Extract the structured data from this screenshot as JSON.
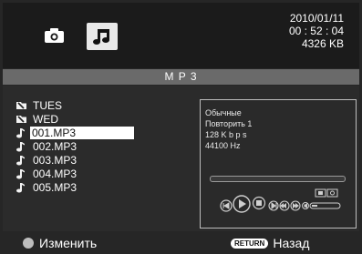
{
  "header": {
    "date": "2010/01/11",
    "time": "00 : 52 : 04",
    "size": "4326  KB",
    "icons": [
      "photo-icon",
      "music-icon"
    ]
  },
  "title": "M P 3",
  "files": [
    {
      "label": "TUES",
      "icon": "folder-icon",
      "selected": false
    },
    {
      "label": "WED",
      "icon": "folder-icon",
      "selected": false
    },
    {
      "label": "001.MP3",
      "icon": "music-note-icon",
      "selected": true
    },
    {
      "label": "002.MP3",
      "icon": "music-note-icon",
      "selected": false
    },
    {
      "label": "003.MP3",
      "icon": "music-note-icon",
      "selected": false
    },
    {
      "label": "004.MP3",
      "icon": "music-note-icon",
      "selected": false
    },
    {
      "label": "005.MP3",
      "icon": "music-note-icon",
      "selected": false
    }
  ],
  "info": {
    "eq": "Обычные",
    "repeat": "Повторить 1",
    "bitrate": "128   K b p s",
    "samplerate": "44100      Hz"
  },
  "progress": 0,
  "footer": {
    "left_label": "Изменить",
    "return_key": "RETURN",
    "right_label": "Назад"
  },
  "colors": {
    "background": "#262626",
    "titlebar": "#6a6a6a",
    "selection": "#ffffff"
  }
}
